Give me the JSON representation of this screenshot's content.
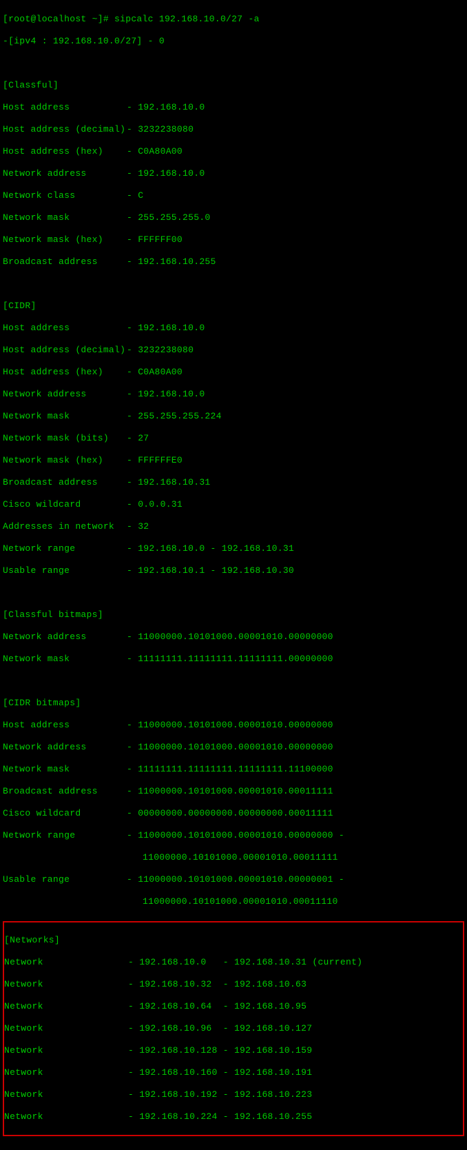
{
  "prompt": {
    "user_host": "[root@localhost ~]# ",
    "command": "sipcalc 192.168.10.0/27 -a"
  },
  "header": "-[ipv4 : 192.168.10.0/27] - 0",
  "classful": {
    "title": "[Classful]",
    "rows": [
      {
        "label": "Host address",
        "value": "192.168.10.0"
      },
      {
        "label": "Host address (decimal)",
        "value": "3232238080"
      },
      {
        "label": "Host address (hex)",
        "value": "C0A80A00"
      },
      {
        "label": "Network address",
        "value": "192.168.10.0"
      },
      {
        "label": "Network class",
        "value": "C"
      },
      {
        "label": "Network mask",
        "value": "255.255.255.0"
      },
      {
        "label": "Network mask (hex)",
        "value": "FFFFFF00"
      },
      {
        "label": "Broadcast address",
        "value": "192.168.10.255"
      }
    ]
  },
  "cidr": {
    "title": "[CIDR]",
    "rows": [
      {
        "label": "Host address",
        "value": "192.168.10.0"
      },
      {
        "label": "Host address (decimal)",
        "value": "3232238080"
      },
      {
        "label": "Host address (hex)",
        "value": "C0A80A00"
      },
      {
        "label": "Network address",
        "value": "192.168.10.0"
      },
      {
        "label": "Network mask",
        "value": "255.255.255.224"
      },
      {
        "label": "Network mask (bits)",
        "value": "27"
      },
      {
        "label": "Network mask (hex)",
        "value": "FFFFFFE0"
      },
      {
        "label": "Broadcast address",
        "value": "192.168.10.31"
      },
      {
        "label": "Cisco wildcard",
        "value": "0.0.0.31"
      },
      {
        "label": "Addresses in network",
        "value": "32"
      },
      {
        "label": "Network range",
        "value": "192.168.10.0 - 192.168.10.31"
      },
      {
        "label": "Usable range",
        "value": "192.168.10.1 - 192.168.10.30"
      }
    ]
  },
  "classful_bitmaps": {
    "title": "[Classful bitmaps]",
    "rows": [
      {
        "label": "Network address",
        "value": "11000000.10101000.00001010.00000000"
      },
      {
        "label": "Network mask",
        "value": "11111111.11111111.11111111.00000000"
      }
    ]
  },
  "cidr_bitmaps": {
    "title": "[CIDR bitmaps]",
    "rows": [
      {
        "label": "Host address",
        "value": "11000000.10101000.00001010.00000000"
      },
      {
        "label": "Network address",
        "value": "11000000.10101000.00001010.00000000"
      },
      {
        "label": "Network mask",
        "value": "11111111.11111111.11111111.11100000"
      },
      {
        "label": "Broadcast address",
        "value": "11000000.10101000.00001010.00011111"
      },
      {
        "label": "Cisco wildcard",
        "value": "00000000.00000000.00000000.00011111"
      }
    ],
    "network_range": {
      "label": "Network range",
      "line1": "11000000.10101000.00001010.00000000 -",
      "line2": "11000000.10101000.00001010.00011111"
    },
    "usable_range": {
      "label": "Usable range",
      "line1": "11000000.10101000.00001010.00000001 -",
      "line2": "11000000.10101000.00001010.00011110"
    }
  },
  "networks": {
    "title": "[Networks]",
    "rows": [
      {
        "label": "Network",
        "start": "192.168.10.0   ",
        "end": "192.168.10.31 (current)"
      },
      {
        "label": "Network",
        "start": "192.168.10.32  ",
        "end": "192.168.10.63"
      },
      {
        "label": "Network",
        "start": "192.168.10.64  ",
        "end": "192.168.10.95"
      },
      {
        "label": "Network",
        "start": "192.168.10.96  ",
        "end": "192.168.10.127"
      },
      {
        "label": "Network",
        "start": "192.168.10.128 ",
        "end": "192.168.10.159"
      },
      {
        "label": "Network",
        "start": "192.168.10.160 ",
        "end": "192.168.10.191"
      },
      {
        "label": "Network",
        "start": "192.168.10.192 ",
        "end": "192.168.10.223"
      },
      {
        "label": "Network",
        "start": "192.168.10.224 ",
        "end": "192.168.10.255"
      }
    ]
  },
  "separator": "- "
}
